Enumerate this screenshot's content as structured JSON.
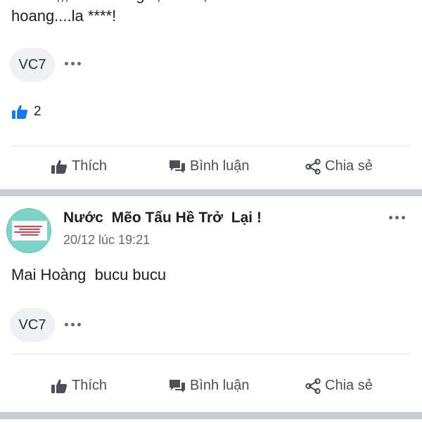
{
  "post1": {
    "text_line1": "ioikor i,,, xieuhuhhgia, xouh , con bucu mai",
    "text_line2": "hoang....la ****!",
    "commenter_chip": "VC7",
    "like_count": "2",
    "actions": {
      "like": "Thích",
      "comment": "Bình luận",
      "share": "Chia sẻ"
    }
  },
  "post2": {
    "author": "Nước  Mẽo Tấu Hề Trở  Lại !",
    "time": "20/12 lúc 19:21",
    "body": "Mai Hoàng  bucu bucu",
    "commenter_chip": "VC7",
    "actions": {
      "like": "Thích",
      "comment": "Bình luận",
      "share": "Chia sẻ"
    }
  },
  "colors": {
    "like_blue": "#1877f2",
    "icon_gray": "#4b4f56",
    "separator": "#c9ccd1",
    "avatar_bg": "#7dd3c4"
  },
  "icons": [
    "thumbs-up-icon",
    "comment-icon",
    "share-icon",
    "more-dots-icon"
  ]
}
